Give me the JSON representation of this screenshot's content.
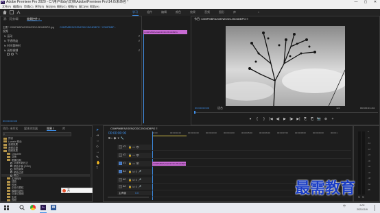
{
  "app": {
    "logo_text": "Pr",
    "window_title": "Adobe Premiere Pro 2020 - C:\\用户\\Ibby\\文档\\Adobe\\Premiere Pro\\14.0\\未命名 *",
    "win_buttons": [
      "—",
      "▢",
      "✕"
    ]
  },
  "menu": [
    "文件(F)",
    "编辑(E)",
    "剪辑(C)",
    "序列(S)",
    "标记(M)",
    "图形(G)",
    "视图(V)",
    "窗口(W)",
    "帮助(H)"
  ],
  "workspaces": {
    "items": [
      "学习",
      "组件",
      "编辑",
      "颜色",
      "效果",
      "音频",
      "图形",
      "库"
    ],
    "active_index": 0,
    "more": "»"
  },
  "source_panel": {
    "tabs": [
      "源:（无剪辑）",
      "效果控件 ≡"
    ],
    "header_left": "主要 * C0MPMBFA2GENZODCJ5O4DBPG.jpg",
    "header_right": "C0MPMBFA2GENZODCJ5O4DBPG * C0MPMBF...",
    "section_video": "视频",
    "rows": [
      "fx 运动",
      "fx 不透明度",
      "fx 时间重映射",
      "fx 高斯模糊"
    ],
    "clip_label": "C0MPMBFA2GENZODCJ5O4DBPG",
    "timecode": "00:00:00:00"
  },
  "program_panel": {
    "title": "节目: C0MPMBFA2GENZODCJ5O4DBPG ≡",
    "timecode_left": "00:00:00:00",
    "fit": "适合",
    "scale": "1/2",
    "timecode_right": "00:00:01:24",
    "controls": [
      "▾",
      "{",
      "}",
      "|◀",
      "◀|",
      "▶",
      "|▶",
      "▶|",
      "⎘",
      "⎗",
      "📷",
      "⊕",
      "+"
    ]
  },
  "project_panel": {
    "tabs": [
      "项目: 未命名",
      "媒体浏览器",
      "效果 ≡",
      "库"
    ],
    "search_placeholder": "",
    "tree": [
      {
        "label": "预设",
        "indent": 0,
        "folder": true
      },
      {
        "label": "Lumetri 预设",
        "indent": 0,
        "folder": true
      },
      {
        "label": "音频效果",
        "indent": 0,
        "folder": true
      },
      {
        "label": "音频过渡",
        "indent": 0,
        "folder": true
      },
      {
        "label": "视频效果",
        "indent": 0,
        "folder": true
      },
      {
        "label": "Obsolete",
        "indent": 1,
        "folder": true
      },
      {
        "label": "变换",
        "indent": 1,
        "folder": true
      },
      {
        "label": "图像控制",
        "indent": 1,
        "folder": true
      },
      {
        "label": "灰度系数校正",
        "indent": 2,
        "folder": false
      },
      {
        "label": "颜色平衡 (RGB)",
        "indent": 2,
        "folder": false
      },
      {
        "label": "颜色替换",
        "indent": 2,
        "folder": false
      },
      {
        "label": "颜色过滤",
        "indent": 2,
        "folder": false
      },
      {
        "label": "黑白",
        "indent": 2,
        "folder": false,
        "selected": true
      },
      {
        "label": "实用程序",
        "indent": 1,
        "folder": true
      },
      {
        "label": "扭曲",
        "indent": 1,
        "folder": true
      },
      {
        "label": "时间",
        "indent": 1,
        "folder": true
      },
      {
        "label": "杂色与颗粒",
        "indent": 1,
        "folder": true
      },
      {
        "label": "模糊与锐化",
        "indent": 1,
        "folder": true
      },
      {
        "label": "沉浸式视频",
        "indent": 1,
        "folder": true
      },
      {
        "label": "生成",
        "indent": 1,
        "folder": true
      },
      {
        "label": "视频",
        "indent": 1,
        "folder": true
      }
    ]
  },
  "timeline": {
    "title": "C0MPMBFA2GENZODCJ5O4DBPG ≡",
    "timecode": "00:00:00:00",
    "ruler": [
      "00:00",
      "00:00:01:00",
      "00:00:02:00",
      "00:00:03:00",
      "00:00:04:00",
      "00:00:05:00",
      "00:00:06:00",
      "00:00:07:00",
      "00:00:08:00",
      "00:00:09:00",
      "00:00:1"
    ],
    "tracks": [
      "V3",
      "V2",
      "V1",
      "A1",
      "A2",
      "A3",
      "主声道"
    ],
    "master_value": "0.0",
    "clip_label": "C0MPMBFA2GENZODCJ5O4DBPG.jpg",
    "audio_meter_labels": [
      "0",
      "-6",
      "-12",
      "-18",
      "-24",
      "-30",
      "-36",
      "-42",
      "-48",
      "-54",
      "dB"
    ],
    "solo": [
      "S",
      "S"
    ]
  },
  "watermark": {
    "text": "最需教育"
  },
  "taskbar": {
    "time": "9:02",
    "date": "2021/11/9",
    "ime": "中",
    "lang": "英"
  },
  "colors": {
    "accent": "#3d8ee8",
    "clip": "#c86bd3",
    "watermark": "#1a3dc4"
  }
}
